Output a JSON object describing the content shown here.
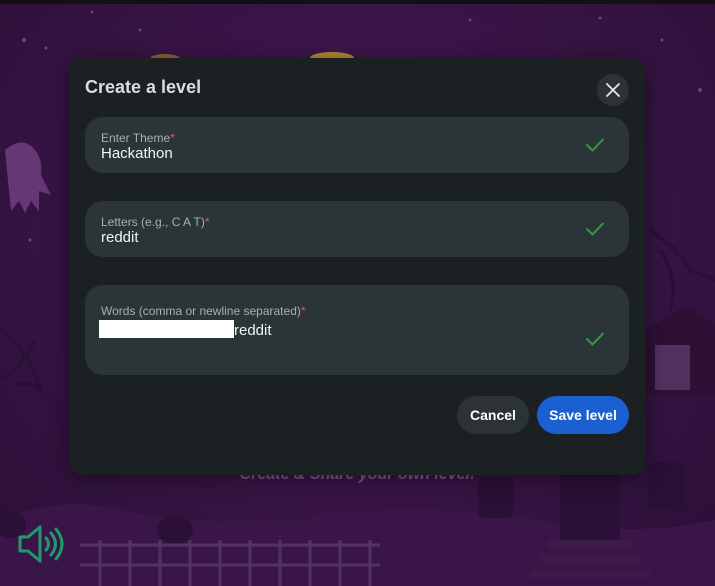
{
  "background": {
    "tagline": "Create & Share your own level!",
    "speaker_icon": "speaker-volume-icon"
  },
  "modal": {
    "title": "Create a level",
    "close_icon": "close-icon",
    "fields": [
      {
        "label": "Enter Theme",
        "required_mark": "*",
        "value": "Hackathon",
        "status_icon": "check-icon"
      },
      {
        "label": "Letters (e.g., C A T)",
        "required_mark": "*",
        "value": "reddit",
        "status_icon": "check-icon"
      },
      {
        "label": "Words (comma or newline separated)",
        "required_mark": "*",
        "value": "reddit",
        "status_icon": "check-icon"
      }
    ],
    "buttons": {
      "cancel": "Cancel",
      "save": "Save level"
    }
  },
  "colors": {
    "accent": "#1b5fd1",
    "valid": "#2e9a44",
    "required": "#e35b5b"
  }
}
